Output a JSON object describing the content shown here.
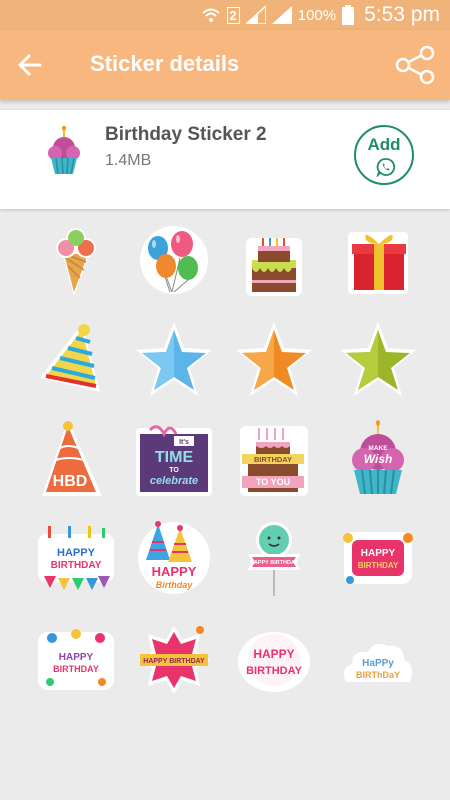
{
  "status_bar": {
    "sim": "2",
    "battery": "100%",
    "time": "5:53 pm"
  },
  "app_bar": {
    "title": "Sticker details",
    "back_icon": "arrow-back-icon",
    "share_icon": "share-icon"
  },
  "pack": {
    "name": "Birthday Sticker 2",
    "size": "1.4MB",
    "add_label": "Add",
    "add_icon": "whatsapp-icon"
  },
  "colors": {
    "status_bar": "#f0b37a",
    "app_bar": "#f8b77e",
    "add_button": "#1f8c6e",
    "background": "#ebebeb"
  },
  "stickers": {
    "hbd_hat": "HBD",
    "time_box_line1": "TIME",
    "time_box_line2": "celebrate",
    "time_box_small": "It's",
    "time_box_to": "TO",
    "cake_banner1": "BIRTHDAY",
    "cake_banner2": "TO YOU",
    "cupcake_text1": "MAKE",
    "cupcake_text2": "Wish",
    "hb1_l1": "HAPPY",
    "hb1_l2": "BIRTHDAY",
    "hb2_l1": "HAPPY",
    "hb2_l2": "Birthday",
    "balloon_text": "HAPPY BIRTHDAY",
    "hb3_l1": "HAPPY",
    "hb3_l2": "BIRTHDAY",
    "hb4_l1": "HAPPY",
    "hb4_l2": "BIRTHDAY",
    "hb5": "HAPPY BIRTHDAY",
    "hb6_l1": "HAPPY",
    "hb6_l2": "BIRTHDAY",
    "hb7_l1": "HaPPy",
    "hb7_l2": "BIRThDaY"
  }
}
